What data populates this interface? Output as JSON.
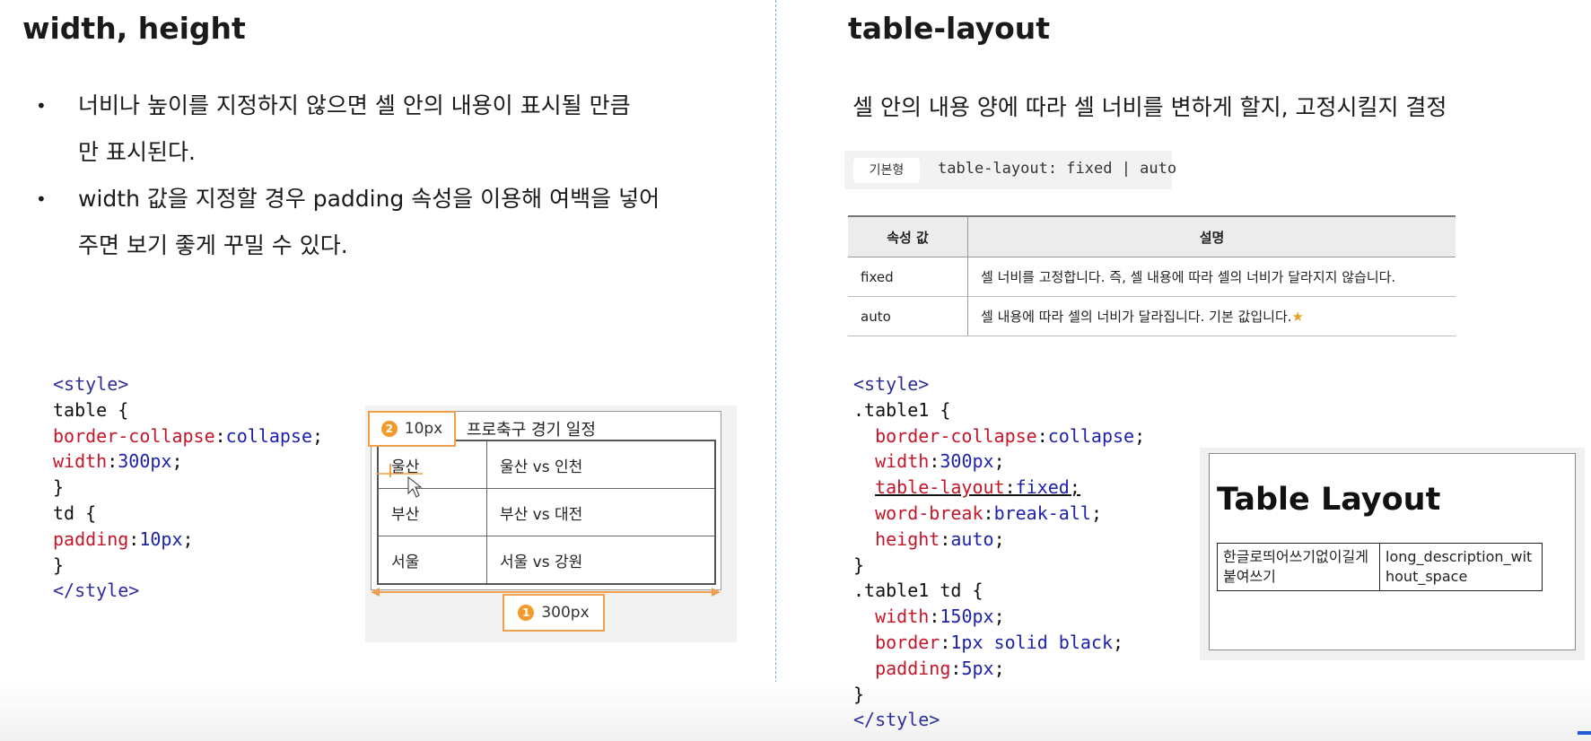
{
  "left": {
    "title": "width, height",
    "bullets": [
      {
        "line1": "너비나 높이를 지정하지 않으면 셀 안의 내용이 표시될 만큼",
        "line2": "만 표시된다."
      },
      {
        "line1": "width 값을 지정할 경우 padding 속성을 이용해 여백을 넣어",
        "line2": "주면 보기 좋게 꾸밀 수 있다."
      }
    ],
    "bullet_char": "•",
    "code": {
      "style_open": "<style>",
      "table_sel": "table {",
      "p1_name": "border-collapse",
      "p1_val": "collapse",
      "p2_name": "width",
      "p2_val": "300px",
      "close1": "}",
      "td_sel": "td {",
      "p3_name": "padding",
      "p3_val": "10px",
      "close2": "}",
      "style_close": "</style>"
    },
    "demo": {
      "caption": "프로축구 경기 일정",
      "rows": [
        [
          "울산",
          "울산 vs 인천"
        ],
        [
          "부산",
          "부산 vs 대전"
        ],
        [
          "서울",
          "서울 vs 강원"
        ]
      ],
      "callout_padding": {
        "num": "2",
        "label": "10px"
      },
      "callout_width": {
        "num": "1",
        "label": "300px"
      }
    }
  },
  "right": {
    "title": "table-layout",
    "description": "셀 안의 내용 양에 따라 셀 너비를 변하게 할지, 고정시킬지 결정",
    "syntax_label": "기본형",
    "syntax": "table-layout: fixed | auto",
    "prop_table": {
      "headers": [
        "속성 값",
        "설명"
      ],
      "rows": [
        [
          "fixed",
          "셀 너비를 고정합니다. 즉, 셀 내용에 따라 셀의 너비가 달라지지 않습니다."
        ],
        [
          "auto",
          "셀 내용에 따라 셀의 너비가 달라집니다. 기본 값입니다."
        ]
      ],
      "star": "★"
    },
    "code": {
      "style_open": "<style>",
      "sel1": ".table1 {",
      "p1_name": "border-collapse",
      "p1_val": "collapse",
      "p2_name": "width",
      "p2_val": "300px",
      "p3_name": "table-layout",
      "p3_val": "fixed",
      "p4_name": "word-break",
      "p4_val": "break-all",
      "p5_name": "height",
      "p5_val": "auto",
      "close1": "}",
      "sel2": ".table1 td {",
      "p6_name": "width",
      "p6_val": "150px",
      "p7_name": "border",
      "p7_val": "1px solid black",
      "p8_name": "padding",
      "p8_val": "5px",
      "close2": "}",
      "style_close": "</style>"
    },
    "demo": {
      "title": "Table Layout",
      "cell1": "한글로띄어쓰기없이길게붙여쓰기",
      "cell2": "long_description_without_space"
    }
  }
}
